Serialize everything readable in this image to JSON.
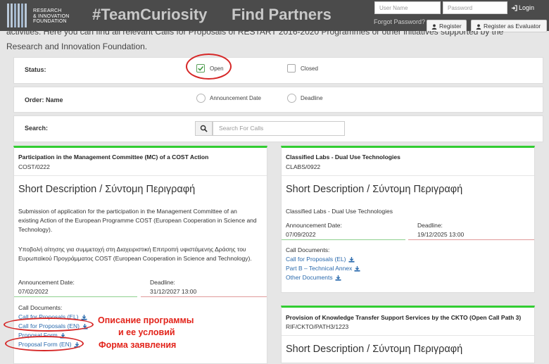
{
  "header": {
    "logo_lines": [
      "RESEARCH",
      "& INNOVATION",
      "FOUNDATION"
    ],
    "hashtag": "#TeamCuriosity",
    "title": "Find Partners",
    "username_placeholder": "User Name",
    "password_placeholder": "Password",
    "login_label": "Login",
    "forgot_label": "Forgot Password?",
    "register_label": "Register",
    "register_evaluator_label": "Register as Evaluator"
  },
  "intro": {
    "line1": "activities. Here you can find all relevant Calls for Proposals of RESTART 2016-2020 Programmes or other initiatives supported by the",
    "line2": "Research and Innovation Foundation."
  },
  "filters": {
    "status_label": "Status:",
    "status_open": "Open",
    "status_closed": "Closed",
    "order_label": "Order: Name",
    "order_announcement": "Announcement Date",
    "order_deadline": "Deadline",
    "search_label": "Search:",
    "search_placeholder": "Search For Calls"
  },
  "cards": [
    {
      "title": "Participation in the Management Committee (MC) of a COST Action",
      "code": "COST/0222",
      "heading": "Short Description / Σύντομη Περιγραφή",
      "desc_en": [
        "Submission of application for the participation in the Management Committee of an",
        "existing Action of the European Programme COST (European Cooperation in Science and",
        "Technology)."
      ],
      "desc_el": [
        "Υποβολή αίτησης για συμμετοχή στη Διαχειριστική Επιτροπή υφιστάμενης Δράσης του",
        "Ευρωπαϊκού Προγράμματος COST (European Cooperation in Science and Technology)."
      ],
      "announcement_label": "Announcement Date:",
      "announcement_value": "07/02/2022",
      "deadline_label": "Deadline:",
      "deadline_value": "31/12/2027 13:00",
      "docs_label": "Call Documents:",
      "docs": [
        "Call for Proposals (EL)",
        "Call for Proposals (EN)",
        "Proposal Form",
        "Proposal Form (EN)"
      ]
    },
    {
      "title": "Classified Labs - Dual Use Technologies",
      "code": "CLABS/0922",
      "heading": "Short Description / Σύντομη Περιγραφή",
      "desc": "Classified Labs - Dual Use Technologies",
      "announcement_label": "Announcement Date:",
      "announcement_value": "07/09/2022",
      "deadline_label": "Deadline:",
      "deadline_value": "19/12/2025 13:00",
      "docs_label": "Call Documents:",
      "docs": [
        "Call for Proposals (EL)",
        "Part B – Technical Annex",
        "Other Documents"
      ]
    },
    {
      "title": "Provision of Knowledge Transfer Support Services by the CKTO (Open Call Path 3)",
      "code": "RIF/CKTO/PATH3/1223",
      "heading": "Short Description / Σύντομη Περιγραφή"
    }
  ],
  "annotations": {
    "line1": "Описание программы",
    "line2": "и ее условий",
    "line3": "Форма заявления"
  },
  "colors": {
    "header_bg": "#4b4b4b",
    "accent_green": "#32cd32",
    "link_blue": "#2a6aad",
    "annotation_red": "#e2231a"
  }
}
